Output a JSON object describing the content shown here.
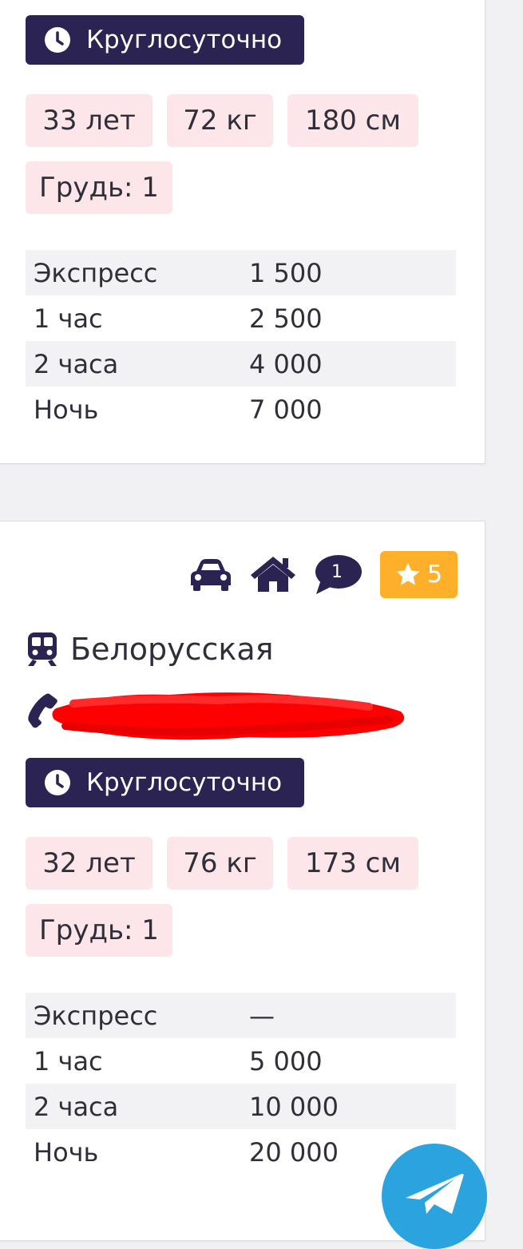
{
  "cards": [
    {
      "hours": "Круглосуточно",
      "params": [
        "33 лет",
        "72 кг",
        "180 см",
        "Грудь: 1"
      ],
      "prices": [
        {
          "label": "Экспресс",
          "value": "1 500"
        },
        {
          "label": "1 час",
          "value": "2 500"
        },
        {
          "label": "2 часа",
          "value": "4 000"
        },
        {
          "label": "Ночь",
          "value": "7 000"
        }
      ]
    },
    {
      "icons": [
        "car-icon",
        "home-icon",
        "comment-icon",
        "star-icon"
      ],
      "comments_count": "1",
      "rating": "5",
      "metro": "Белорусская",
      "phone_redacted": true,
      "hours": "Круглосуточно",
      "params": [
        "32 лет",
        "76 кг",
        "173 см",
        "Грудь: 1"
      ],
      "prices": [
        {
          "label": "Экспресс",
          "value": "—"
        },
        {
          "label": "1 час",
          "value": "5 000"
        },
        {
          "label": "2 часа",
          "value": "10 000"
        },
        {
          "label": "Ночь",
          "value": "20 000"
        }
      ]
    }
  ],
  "colors": {
    "accent": "#2b2453",
    "chip": "#fde6ea",
    "rating": "#ffb02a",
    "telegram": "#2aa3df",
    "redaction": "#ff0000"
  },
  "fab": {
    "icon": "telegram-icon"
  }
}
